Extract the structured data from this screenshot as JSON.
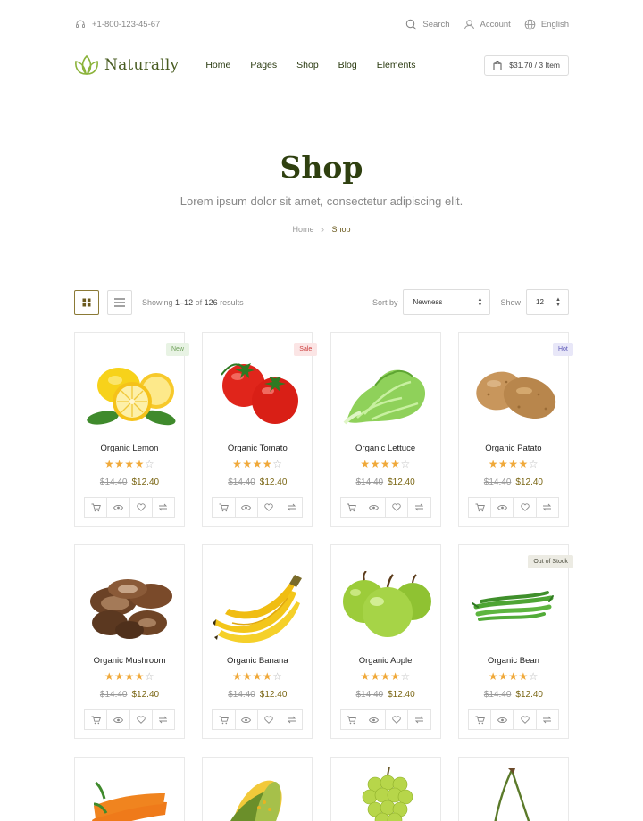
{
  "topbar": {
    "phone": "+1-800-123-45-67",
    "search_label": "Search",
    "account_label": "Account",
    "language_label": "English"
  },
  "brand": {
    "name": "Naturally",
    "color": "#4a5d23",
    "accent": "#8bb33a"
  },
  "nav": {
    "items": [
      {
        "label": "Home"
      },
      {
        "label": "Pages"
      },
      {
        "label": "Shop"
      },
      {
        "label": "Blog"
      },
      {
        "label": "Elements"
      }
    ],
    "cart_label": "$31.70 / 3 Item"
  },
  "hero": {
    "title": "Shop",
    "subtitle": "Lorem ipsum dolor sit amet, consectetur adipiscing elit.",
    "breadcrumb": {
      "home": "Home",
      "current": "Shop"
    }
  },
  "toolbar": {
    "showing_prefix": "Showing",
    "showing_range": "1–12",
    "showing_of": "of",
    "showing_total": "126",
    "showing_suffix": "results",
    "sort_label": "Sort by",
    "sort_value": "Newness",
    "show_label": "Show",
    "show_value": "12"
  },
  "products": [
    {
      "name": "Organic Lemon",
      "badge": "New",
      "badge_type": "new",
      "old_price": "$14.40",
      "price": "$12.40",
      "rating": 4,
      "icon": "lemon"
    },
    {
      "name": "Organic Tomato",
      "badge": "Sale",
      "badge_type": "sale",
      "old_price": "$14.40",
      "price": "$12.40",
      "rating": 4,
      "icon": "tomato"
    },
    {
      "name": "Organic Lettuce",
      "badge": "",
      "badge_type": "",
      "old_price": "$14.40",
      "price": "$12.40",
      "rating": 4,
      "icon": "lettuce"
    },
    {
      "name": "Organic Patato",
      "badge": "Hot",
      "badge_type": "hot",
      "old_price": "$14.40",
      "price": "$12.40",
      "rating": 4,
      "icon": "potato"
    },
    {
      "name": "Organic Mushroom",
      "badge": "",
      "badge_type": "",
      "old_price": "$14.40",
      "price": "$12.40",
      "rating": 4,
      "icon": "mushroom"
    },
    {
      "name": "Organic Banana",
      "badge": "",
      "badge_type": "",
      "old_price": "$14.40",
      "price": "$12.40",
      "rating": 4,
      "icon": "banana"
    },
    {
      "name": "Organic Apple",
      "badge": "",
      "badge_type": "",
      "old_price": "$14.40",
      "price": "$12.40",
      "rating": 4,
      "icon": "apple"
    },
    {
      "name": "Organic Bean",
      "badge": "Out of Stock",
      "badge_type": "out",
      "old_price": "$14.40",
      "price": "$12.40",
      "rating": 4,
      "icon": "bean"
    }
  ],
  "partial_products": [
    {
      "icon": "carrot"
    },
    {
      "icon": "corn"
    },
    {
      "icon": "grapes"
    },
    {
      "icon": "cherry"
    }
  ],
  "colors": {
    "star": "#f0a93a",
    "price": "#7a6614",
    "title": "#2f4010"
  }
}
